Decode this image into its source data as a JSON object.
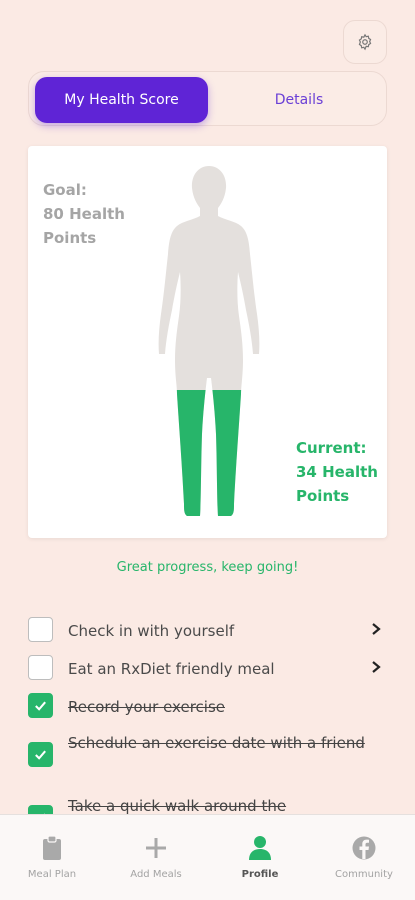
{
  "tabs": {
    "active_label": "My Health Score",
    "inactive_label": "Details"
  },
  "score_card": {
    "goal_lines": [
      "Goal:",
      "80 Health",
      "Points"
    ],
    "current_lines": [
      "Current:",
      "34 Health",
      "Points"
    ],
    "goal_points": 80,
    "current_points": 34
  },
  "progress_message": "Great progress, keep going!",
  "tasks": [
    {
      "label": "Check in with yourself",
      "done": false
    },
    {
      "label": "Eat an RxDiet friendly meal",
      "done": false
    },
    {
      "label": "Record your exercise",
      "done": true
    },
    {
      "label": "Schedule an exercise date with a friend",
      "done": true
    },
    {
      "label": "Take a quick walk around the",
      "done": true
    }
  ],
  "bottom_nav": [
    {
      "label": "Meal Plan",
      "icon": "clipboard-icon"
    },
    {
      "label": "Add Meals",
      "icon": "plus-icon"
    },
    {
      "label": "Profile",
      "icon": "person-icon"
    },
    {
      "label": "Community",
      "icon": "facebook-icon"
    }
  ],
  "colors": {
    "accent": "#5f24d6",
    "success": "#27b56a",
    "background": "#fbeae4"
  }
}
